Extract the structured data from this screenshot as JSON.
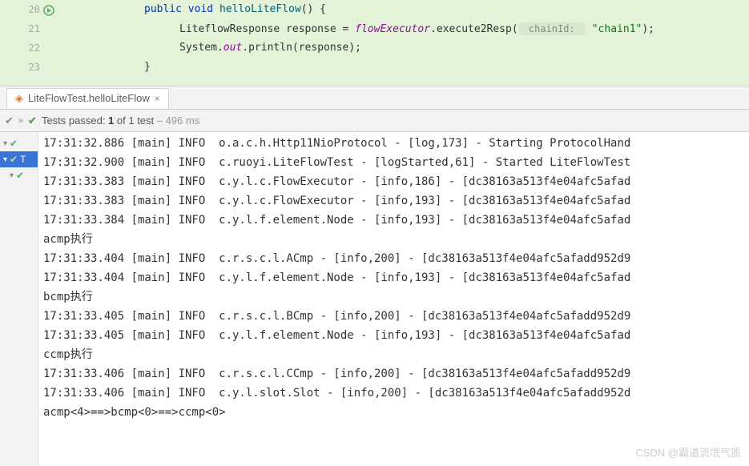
{
  "editor": {
    "lines": [
      {
        "num": "20",
        "indent": 1,
        "segments": [
          {
            "t": "public ",
            "c": "kw"
          },
          {
            "t": "void ",
            "c": "kw"
          },
          {
            "t": "helloLiteFlow",
            "c": "method"
          },
          {
            "t": "() {",
            "c": ""
          }
        ],
        "icon": "rerun"
      },
      {
        "num": "21",
        "indent": 2,
        "segments": [
          {
            "t": "LiteflowResponse response = ",
            "c": ""
          },
          {
            "t": "flowExecutor",
            "c": "field-italic"
          },
          {
            "t": ".execute2Resp(",
            "c": ""
          },
          {
            "t": " chainId: ",
            "c": "hint"
          },
          {
            "t": " ",
            "c": ""
          },
          {
            "t": "\"chain1\"",
            "c": "str"
          },
          {
            "t": ");",
            "c": ""
          }
        ]
      },
      {
        "num": "22",
        "indent": 2,
        "segments": [
          {
            "t": "System.",
            "c": ""
          },
          {
            "t": "out",
            "c": "field-italic"
          },
          {
            "t": ".println(response);",
            "c": ""
          }
        ]
      },
      {
        "num": "23",
        "indent": 1,
        "segments": [
          {
            "t": "}",
            "c": ""
          }
        ]
      }
    ]
  },
  "tab": {
    "label": "LiteFlowTest.helloLiteFlow"
  },
  "status": {
    "prefix": "Tests passed: ",
    "passed": "1",
    "mid": " of 1 test",
    "time": " – 496 ms"
  },
  "tree": [
    {
      "label": "T",
      "sel": true
    },
    {
      "label": "",
      "sel": false
    }
  ],
  "console_lines": [
    "17:31:32.886 [main] INFO  o.a.c.h.Http11NioProtocol - [log,173] - Starting ProtocolHand",
    "17:31:32.900 [main] INFO  c.ruoyi.LiteFlowTest - [logStarted,61] - Started LiteFlowTest",
    "17:31:33.383 [main] INFO  c.y.l.c.FlowExecutor - [info,186] - [dc38163a513f4e04afc5afad",
    "17:31:33.383 [main] INFO  c.y.l.c.FlowExecutor - [info,193] - [dc38163a513f4e04afc5afad",
    "17:31:33.384 [main] INFO  c.y.l.f.element.Node - [info,193] - [dc38163a513f4e04afc5afad",
    "acmp执行",
    "17:31:33.404 [main] INFO  c.r.s.c.l.ACmp - [info,200] - [dc38163a513f4e04afc5afadd952d9",
    "17:31:33.404 [main] INFO  c.y.l.f.element.Node - [info,193] - [dc38163a513f4e04afc5afad",
    "bcmp执行",
    "17:31:33.405 [main] INFO  c.r.s.c.l.BCmp - [info,200] - [dc38163a513f4e04afc5afadd952d9",
    "17:31:33.405 [main] INFO  c.y.l.f.element.Node - [info,193] - [dc38163a513f4e04afc5afad",
    "ccmp执行",
    "17:31:33.406 [main] INFO  c.r.s.c.l.CCmp - [info,200] - [dc38163a513f4e04afc5afadd952d9",
    "17:31:33.406 [main] INFO  c.y.l.slot.Slot - [info,200] - [dc38163a513f4e04afc5afadd952d",
    "acmp<4>==>bcmp<0>==>ccmp<0>"
  ],
  "watermark": "CSDN @霸道流氓气质"
}
